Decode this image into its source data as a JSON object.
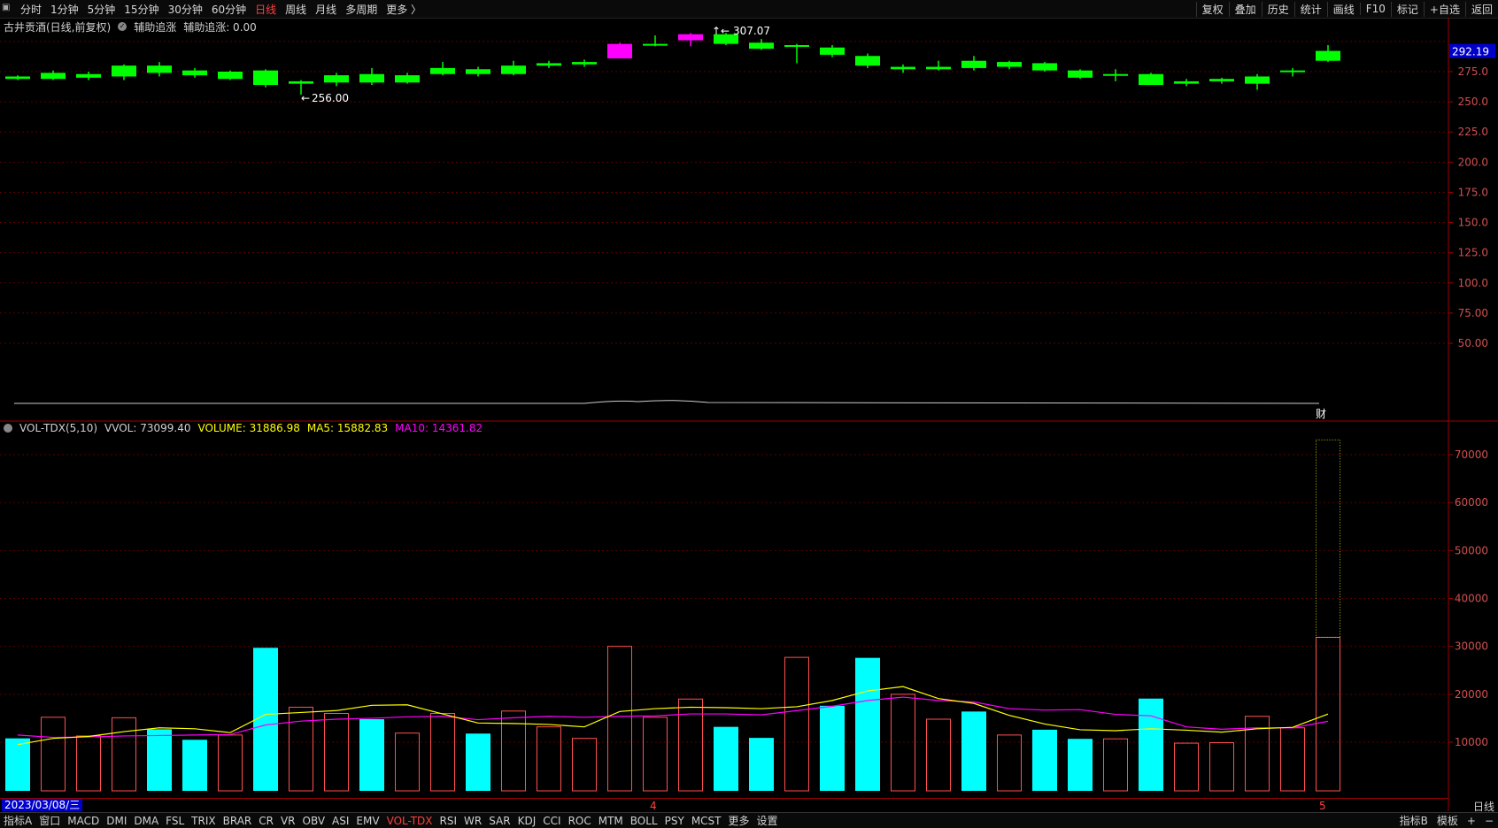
{
  "topbar": {
    "nav": [
      "分时",
      "1分钟",
      "5分钟",
      "15分钟",
      "30分钟",
      "60分钟",
      "日线",
      "周线",
      "月线",
      "多周期",
      "更多 〉"
    ],
    "active_index": 6,
    "right": [
      "复权",
      "叠加",
      "历史",
      "统计",
      "画线",
      "F10",
      "标记",
      "+自选",
      "返回"
    ]
  },
  "info": {
    "title": "古井贡酒(日线,前复权)",
    "indicator": "辅助追涨",
    "indicator_value": "辅助追涨: 0.00"
  },
  "price_axis": {
    "labels": [
      "275.0",
      "250.0",
      "225.0",
      "200.0",
      "175.0",
      "150.0",
      "125.0",
      "100.0",
      "75.00",
      "50.00"
    ],
    "values": [
      275,
      250,
      225,
      200,
      175,
      150,
      125,
      100,
      75,
      50
    ],
    "current": "292.19",
    "current_value": 292.19
  },
  "price_annotations": {
    "high": "307.07",
    "low": "256.00"
  },
  "volume_info": {
    "name": "VOL-TDX(5,10)",
    "vvol": "VVOL: 73099.40",
    "volume": "VOLUME: 31886.98",
    "ma5": "MA5: 15882.83",
    "ma10": "MA10: 14361.82"
  },
  "volume_axis": {
    "labels": [
      "70000",
      "60000",
      "50000",
      "40000",
      "30000",
      "20000",
      "10000"
    ],
    "values": [
      70000,
      60000,
      50000,
      40000,
      30000,
      20000,
      10000
    ]
  },
  "chart_data": {
    "type": "candlestick",
    "candles": [
      {
        "o": 271,
        "c": 269,
        "h": 272,
        "l": 268
      },
      {
        "o": 274,
        "c": 269,
        "h": 276,
        "l": 268
      },
      {
        "o": 273,
        "c": 270,
        "h": 275,
        "l": 268
      },
      {
        "o": 280,
        "c": 271,
        "h": 281,
        "l": 268
      },
      {
        "o": 280,
        "c": 274,
        "h": 283,
        "l": 271
      },
      {
        "o": 276,
        "c": 272,
        "h": 278,
        "l": 270
      },
      {
        "o": 275,
        "c": 269,
        "h": 276,
        "l": 268
      },
      {
        "o": 276,
        "c": 264,
        "h": 277,
        "l": 262
      },
      {
        "o": 267,
        "c": 265,
        "h": 268,
        "l": 256
      },
      {
        "o": 272,
        "c": 266,
        "h": 274,
        "l": 263
      },
      {
        "o": 273,
        "c": 266,
        "h": 278,
        "l": 264
      },
      {
        "o": 272,
        "c": 266,
        "h": 274,
        "l": 265
      },
      {
        "o": 278,
        "c": 273,
        "h": 283,
        "l": 272
      },
      {
        "o": 277,
        "c": 273,
        "h": 279,
        "l": 271
      },
      {
        "o": 280,
        "c": 273,
        "h": 284,
        "l": 272
      },
      {
        "o": 282,
        "c": 280,
        "h": 284,
        "l": 278
      },
      {
        "o": 283,
        "c": 281,
        "h": 285,
        "l": 279
      },
      {
        "o": 286,
        "c": 298,
        "h": 299,
        "l": 286
      },
      {
        "o": 298,
        "c": 297,
        "h": 305,
        "l": 296
      },
      {
        "o": 301,
        "c": 306,
        "h": 307,
        "l": 296
      },
      {
        "o": 306,
        "c": 298,
        "h": 307.07,
        "l": 297
      },
      {
        "o": 299,
        "c": 294,
        "h": 302,
        "l": 293
      },
      {
        "o": 297,
        "c": 296,
        "h": 298,
        "l": 282
      },
      {
        "o": 295,
        "c": 289,
        "h": 297,
        "l": 287
      },
      {
        "o": 288,
        "c": 280,
        "h": 290,
        "l": 278
      },
      {
        "o": 279,
        "c": 277,
        "h": 281,
        "l": 274
      },
      {
        "o": 279,
        "c": 277,
        "h": 284,
        "l": 276
      },
      {
        "o": 284,
        "c": 278,
        "h": 288,
        "l": 276
      },
      {
        "o": 283,
        "c": 279,
        "h": 284,
        "l": 277
      },
      {
        "o": 282,
        "c": 276,
        "h": 283,
        "l": 275
      },
      {
        "o": 276,
        "c": 270,
        "h": 277,
        "l": 269
      },
      {
        "o": 273,
        "c": 272,
        "h": 277,
        "l": 267
      },
      {
        "o": 273,
        "c": 264,
        "h": 274,
        "l": 264
      },
      {
        "o": 267,
        "c": 265,
        "h": 269,
        "l": 263
      },
      {
        "o": 269,
        "c": 267,
        "h": 270,
        "l": 265
      },
      {
        "o": 271,
        "c": 265,
        "h": 273,
        "l": 260
      },
      {
        "o": 276,
        "c": 275,
        "h": 278,
        "l": 271
      },
      {
        "o": 284,
        "c": 292.19,
        "h": 297,
        "l": 283
      }
    ],
    "colors": [
      "green",
      "green",
      "green",
      "green",
      "green",
      "green",
      "green",
      "green",
      "green",
      "green",
      "green",
      "green",
      "green",
      "green",
      "green",
      "green",
      "green",
      "magenta",
      "green",
      "magenta",
      "green",
      "green",
      "green",
      "green",
      "green",
      "green",
      "green",
      "green",
      "green",
      "green",
      "green",
      "green",
      "green",
      "green",
      "green",
      "green",
      "green",
      "green"
    ],
    "volume": {
      "values": [
        10800,
        15200,
        11300,
        15100,
        12700,
        10500,
        11500,
        29700,
        17300,
        16000,
        14800,
        11900,
        16000,
        11800,
        16500,
        13200,
        10800,
        30000,
        15200,
        19000,
        13200,
        10900,
        27700,
        17600,
        27600,
        20000,
        14800,
        16400,
        11500,
        12600,
        10700,
        10700,
        19100,
        9800,
        9900,
        15400,
        13000,
        31887
      ],
      "kind": [
        "up",
        "down",
        "down",
        "down",
        "up",
        "up",
        "down",
        "up",
        "down",
        "down",
        "up",
        "down",
        "down",
        "up",
        "down",
        "down",
        "down",
        "down",
        "down",
        "down",
        "up",
        "up",
        "down",
        "up",
        "up",
        "down",
        "down",
        "up",
        "down",
        "up",
        "up",
        "down",
        "up",
        "down",
        "down",
        "down",
        "down",
        "down"
      ],
      "vvol_last": 73099.4,
      "ma5": [
        9500,
        10800,
        11200,
        12200,
        13000,
        12800,
        12000,
        15800,
        16200,
        16600,
        17700,
        17800,
        15900,
        14000,
        13900,
        13700,
        13200,
        16400,
        17000,
        17300,
        17200,
        17000,
        17400,
        18700,
        20700,
        21600,
        19100,
        18100,
        15600,
        13800,
        12600,
        12400,
        12800,
        12500,
        12100,
        12800,
        13100,
        15882.83
      ],
      "ma10": [
        11500,
        11000,
        11100,
        11300,
        11400,
        11500,
        11600,
        13600,
        14400,
        14800,
        15000,
        15300,
        15400,
        14700,
        15100,
        15400,
        15200,
        15400,
        15500,
        15900,
        15900,
        15700,
        16600,
        17500,
        18700,
        19400,
        18700,
        18400,
        17000,
        16700,
        16800,
        15800,
        15500,
        13200,
        12700,
        13000,
        13000,
        14361.82
      ]
    }
  },
  "bottom": {
    "date": "2023/03/08/三",
    "month_markers": [
      "4",
      "5"
    ],
    "period": "日线",
    "tabs": [
      "指标A",
      "窗口",
      "MACD",
      "DMI",
      "DMA",
      "FSL",
      "TRIX",
      "BRAR",
      "CR",
      "VR",
      "OBV",
      "ASI",
      "EMV",
      "VOL-TDX",
      "RSI",
      "WR",
      "SAR",
      "KDJ",
      "CCI",
      "ROC",
      "MTM",
      "BOLL",
      "PSY",
      "MCST",
      "更多",
      "设置"
    ],
    "active_tab": 13,
    "right": [
      "指标B",
      "模板",
      "+",
      "−"
    ]
  },
  "markers": {
    "finance": "财"
  }
}
